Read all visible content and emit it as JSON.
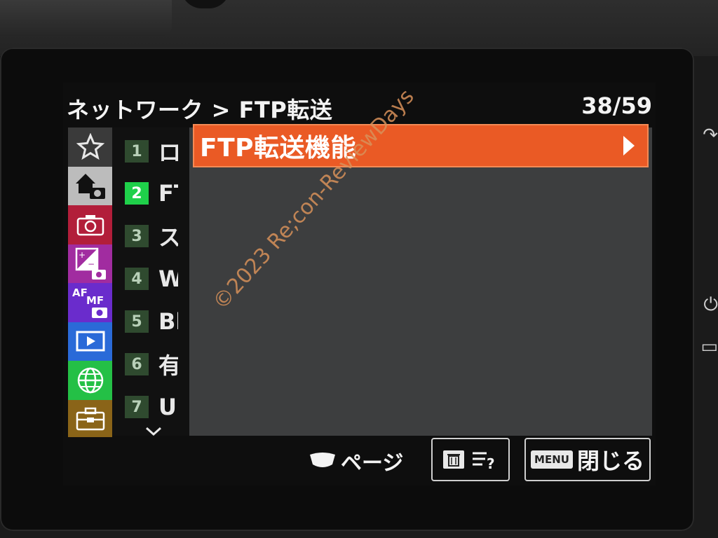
{
  "header": {
    "breadcrumb": "ネットワーク > FTP転送",
    "page_counter": "38/59"
  },
  "categories": [
    {
      "name": "favorites",
      "icon": "star-icon",
      "bg": "#3a3a3a"
    },
    {
      "name": "shooting-main",
      "icon": "home-camera-icon",
      "bg": "#bcbcbc"
    },
    {
      "name": "shooting",
      "icon": "camera-icon",
      "bg": "#b21e3a"
    },
    {
      "name": "exposure-color",
      "icon": "exposure-compensation-icon",
      "bg": "#a12ca0"
    },
    {
      "name": "focus",
      "icon": "af-mf-icon",
      "bg": "#6a2ccc"
    },
    {
      "name": "playback",
      "icon": "playback-icon",
      "bg": "#2a6ad8"
    },
    {
      "name": "network",
      "icon": "globe-icon",
      "bg": "#24c046"
    },
    {
      "name": "setup",
      "icon": "toolbox-icon",
      "bg": "#8a6418"
    }
  ],
  "pages": [
    {
      "num": "1",
      "label": "ロ"
    },
    {
      "num": "2",
      "label": "FT"
    },
    {
      "num": "3",
      "label": "ス"
    },
    {
      "num": "4",
      "label": "Wi"
    },
    {
      "num": "5",
      "label": "Bl"
    },
    {
      "num": "6",
      "label": "有"
    },
    {
      "num": "7",
      "label": "US"
    }
  ],
  "menu_items": [
    {
      "label": "FTP転送機能"
    }
  ],
  "footer": {
    "page_hint": "ページ",
    "close_badge": "MENU",
    "close_label": "閉じる"
  },
  "watermark": "©2023 Re;con-ReviewDays",
  "colors": {
    "highlight": "#ea5a25",
    "selected_page": "#1fd04a",
    "panel_bg": "#3d3e3f"
  }
}
